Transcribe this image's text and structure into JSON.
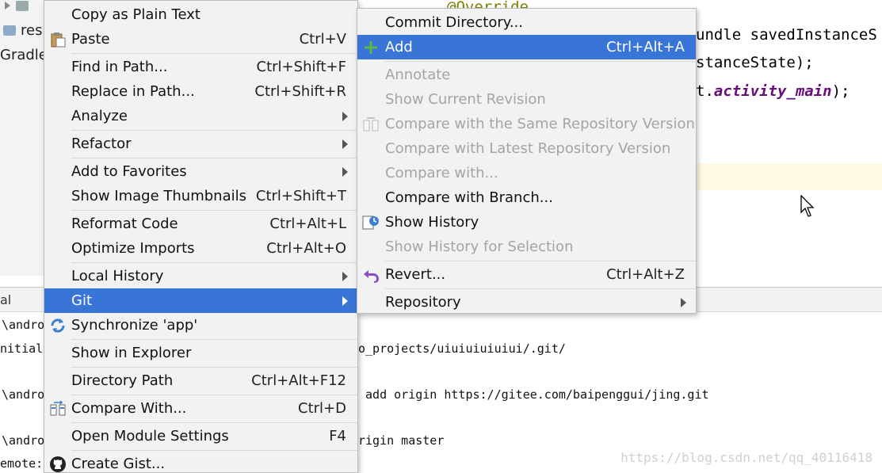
{
  "project_tree": {
    "items": [
      {
        "label": ""
      },
      {
        "label": "res"
      },
      {
        "label": "Gradle"
      }
    ]
  },
  "editor": {
    "annotation": "@Override",
    "lines": [
      {
        "text": "undle savedInstanceS"
      },
      {
        "text": "stanceState);"
      },
      {
        "text_prefix": "t.",
        "text_italic": "activity_main",
        "text_suffix": ");"
      }
    ]
  },
  "terminal": {
    "header": "al",
    "lines": [
      {
        "text": "\\andro"
      },
      {
        "text": "nitiali"
      },
      {
        "text": "\\andro"
      },
      {
        "text": "\\andro"
      },
      {
        "text": "emote:"
      }
    ],
    "right_lines": [
      {
        "text": "o_projects/uiuiuiuiuiui/.git/"
      },
      {
        "text": " add origin https://gitee.com/baipenggui/jing.git"
      },
      {
        "text": "rigin master"
      }
    ]
  },
  "watermark": "https://blog.csdn.net/qq_40116418",
  "context_menu": {
    "items": [
      {
        "label": "Copy as Plain Text",
        "shortcut": "",
        "icon": "",
        "submenu": false
      },
      {
        "label": "Paste",
        "shortcut": "Ctrl+V",
        "icon": "paste-icon",
        "submenu": false
      },
      {
        "label": "Find in Path...",
        "shortcut": "Ctrl+Shift+F",
        "icon": "",
        "submenu": false
      },
      {
        "label": "Replace in Path...",
        "shortcut": "Ctrl+Shift+R",
        "icon": "",
        "submenu": false
      },
      {
        "label": "Analyze",
        "shortcut": "",
        "icon": "",
        "submenu": true
      },
      {
        "label": "Refactor",
        "shortcut": "",
        "icon": "",
        "submenu": true
      },
      {
        "label": "Add to Favorites",
        "shortcut": "",
        "icon": "",
        "submenu": true
      },
      {
        "label": "Show Image Thumbnails",
        "shortcut": "Ctrl+Shift+T",
        "icon": "",
        "submenu": false
      },
      {
        "label": "Reformat Code",
        "shortcut": "Ctrl+Alt+L",
        "icon": "",
        "submenu": false
      },
      {
        "label": "Optimize Imports",
        "shortcut": "Ctrl+Alt+O",
        "icon": "",
        "submenu": false
      },
      {
        "label": "Local History",
        "shortcut": "",
        "icon": "",
        "submenu": true
      },
      {
        "label": "Git",
        "shortcut": "",
        "icon": "",
        "submenu": true,
        "selected": true
      },
      {
        "label": "Synchronize 'app'",
        "shortcut": "",
        "icon": "sync-icon",
        "submenu": false
      },
      {
        "label": "Show in Explorer",
        "shortcut": "",
        "icon": "",
        "submenu": false
      },
      {
        "label": "Directory Path",
        "shortcut": "Ctrl+Alt+F12",
        "icon": "",
        "submenu": false
      },
      {
        "label": "Compare With...",
        "shortcut": "Ctrl+D",
        "icon": "compare-icon",
        "submenu": false
      },
      {
        "label": "Open Module Settings",
        "shortcut": "F4",
        "icon": "",
        "submenu": false
      },
      {
        "label": "Create Gist...",
        "shortcut": "",
        "icon": "github-icon",
        "submenu": false
      }
    ]
  },
  "git_submenu": {
    "items": [
      {
        "label": "Commit Directory...",
        "shortcut": "",
        "disabled": false
      },
      {
        "label": "Add",
        "shortcut": "Ctrl+Alt+A",
        "icon": "plus-icon",
        "selected": true,
        "disabled": false
      },
      {
        "label": "Annotate",
        "shortcut": "",
        "disabled": true
      },
      {
        "label": "Show Current Revision",
        "shortcut": "",
        "disabled": true
      },
      {
        "label": "Compare with the Same Repository Version",
        "shortcut": "",
        "icon": "compare-icon",
        "disabled": true
      },
      {
        "label": "Compare with Latest Repository Version",
        "shortcut": "",
        "disabled": true
      },
      {
        "label": "Compare with...",
        "shortcut": "",
        "disabled": true
      },
      {
        "label": "Compare with Branch...",
        "shortcut": "",
        "disabled": false
      },
      {
        "label": "Show History",
        "shortcut": "",
        "icon": "history-icon",
        "disabled": false
      },
      {
        "label": "Show History for Selection",
        "shortcut": "",
        "disabled": true
      },
      {
        "label": "Revert...",
        "shortcut": "Ctrl+Alt+Z",
        "icon": "revert-icon",
        "disabled": false
      },
      {
        "label": "Repository",
        "shortcut": "",
        "submenu": true,
        "disabled": false
      }
    ]
  },
  "colors": {
    "selection": "#3875d7",
    "menu_bg": "#f2f2f2",
    "disabled_text": "#a4a4a4",
    "caret_line": "#fffae3"
  }
}
